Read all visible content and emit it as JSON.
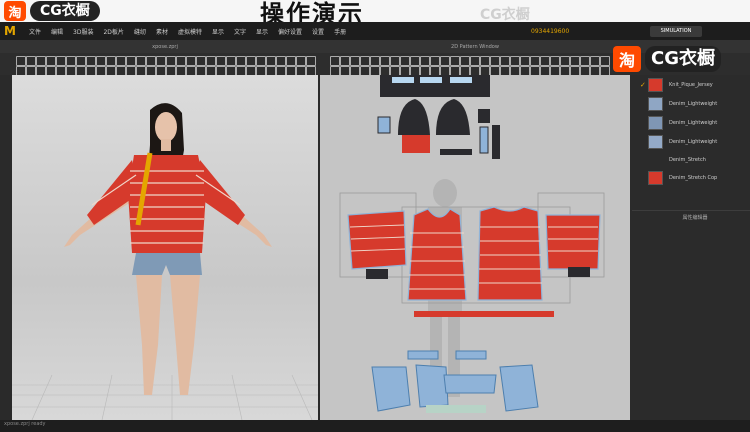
{
  "banner": {
    "badge": "淘",
    "brand": "CG衣橱",
    "title": "操作演示",
    "watermark": "CG衣橱"
  },
  "menu": {
    "logo": "M",
    "items": [
      "文件",
      "编辑",
      "3D服装",
      "2D板片",
      "缝纫",
      "素材",
      "虚拟模特",
      "显示",
      "文字",
      "显示",
      "偏好设置",
      "设置",
      "手册"
    ]
  },
  "header": {
    "user_id": "0934419600",
    "simulation": "SIMULATION"
  },
  "panels": {
    "view3d_title": "xpose.zprj",
    "view2d_title": "2D Pattern Window"
  },
  "overlay_brand": {
    "badge": "淘",
    "text": "CG衣橱"
  },
  "fabrics": [
    {
      "name": "Knit_Pique_Jersey",
      "color": "#d63a2c",
      "checked": true
    },
    {
      "name": "Denim_Lightweight",
      "color": "#8fa6c4",
      "checked": false
    },
    {
      "name": "Denim_Lightweight",
      "color": "#7f96b4",
      "checked": false
    },
    {
      "name": "Denim_Lightweight",
      "color": "#94aac8",
      "checked": false
    },
    {
      "name": "Denim_Stretch",
      "color": "",
      "checked": false
    },
    {
      "name": "Denim_Stretch Cop",
      "color": "#d63a2c",
      "checked": false
    }
  ],
  "property_editor": "属性编辑器",
  "status": {
    "text": "xpose.zprj ready"
  },
  "colors": {
    "shirt": "#d63a2c",
    "denim": "#8fb3d8",
    "accent": "#e4a600"
  },
  "icons": [
    "select-icon",
    "move-icon",
    "fold-icon",
    "pin-icon",
    "avatar-icon",
    "fabric-icon",
    "measure-icon"
  ]
}
